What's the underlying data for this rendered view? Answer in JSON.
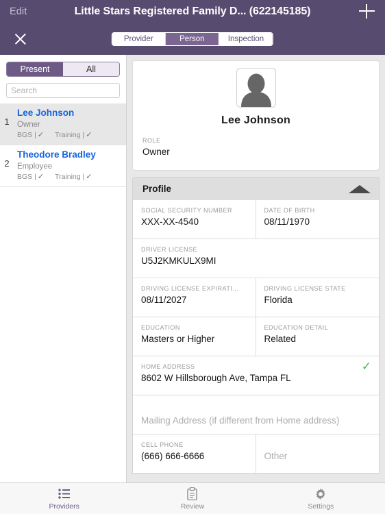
{
  "header": {
    "edit_label": "Edit",
    "title": "Little Stars Registered Family D...  (622145185)",
    "add_icon": "plus-icon",
    "close_icon": "close-icon",
    "segments": [
      {
        "label": "Provider",
        "active": false
      },
      {
        "label": "Person",
        "active": true
      },
      {
        "label": "Inspection",
        "active": false
      }
    ],
    "background_color": "#584B70",
    "segment_active_color": "#7a6691"
  },
  "sidebar": {
    "filter": {
      "options": [
        {
          "label": "Present",
          "active": true
        },
        {
          "label": "All",
          "active": false
        }
      ]
    },
    "search": {
      "placeholder": "Search",
      "value": ""
    },
    "people": [
      {
        "number": "1",
        "name": "Lee Johnson",
        "role": "Owner",
        "badges": [
          {
            "label": "BGS |",
            "check": "✓"
          },
          {
            "label": "Training |",
            "check": "✓"
          }
        ],
        "selected": true
      },
      {
        "number": "2",
        "name": "Theodore Bradley",
        "role": "Employee",
        "badges": [
          {
            "label": "BGS |",
            "check": "✓"
          },
          {
            "label": "Training |",
            "check": "✓"
          }
        ],
        "selected": false
      }
    ],
    "name_color": "#1565e0"
  },
  "main": {
    "profile_card": {
      "avatar_icon": "person-avatar-icon",
      "name": "Lee  Johnson",
      "role_label": "ROLE",
      "role_value": "Owner"
    },
    "section": {
      "title": "Profile",
      "collapse_icon": "triangle-up-icon"
    },
    "fields": {
      "ssn_label": "SOCIAL SECURITY NUMBER",
      "ssn_value": "XXX-XX-4540",
      "dob_label": "DATE OF BIRTH",
      "dob_value": "08/11/1970",
      "driver_license_label": "DRIVER LICENSE",
      "driver_license_value": "U5J2KMKULX9MI",
      "license_exp_label": "DRIVING LICENSE EXPIRATI...",
      "license_exp_value": "08/11/2027",
      "license_state_label": "DRIVING LICENSE STATE",
      "license_state_value": "Florida",
      "education_label": "EDUCATION",
      "education_value": "Masters or Higher",
      "education_detail_label": "EDUCATION DETAIL",
      "education_detail_value": "Related",
      "home_address_label": "HOME ADDRESS",
      "home_address_value": "8602 W Hillsborough Ave, Tampa FL",
      "home_address_verified_icon": "green-check-icon",
      "mailing_address_placeholder": "Mailing Address (if different from Home address)",
      "cell_phone_label": "CELL PHONE",
      "cell_phone_value": "(666) 666-6666",
      "other_phone_placeholder": "Other"
    },
    "verified_color": "#3cba54"
  },
  "tabbar": {
    "tabs": [
      {
        "label": "Providers",
        "icon": "list-icon",
        "active": true
      },
      {
        "label": "Review",
        "icon": "clipboard-icon",
        "active": false
      },
      {
        "label": "Settings",
        "icon": "gear-icon",
        "active": false
      }
    ],
    "active_color": "#6d5b85"
  }
}
